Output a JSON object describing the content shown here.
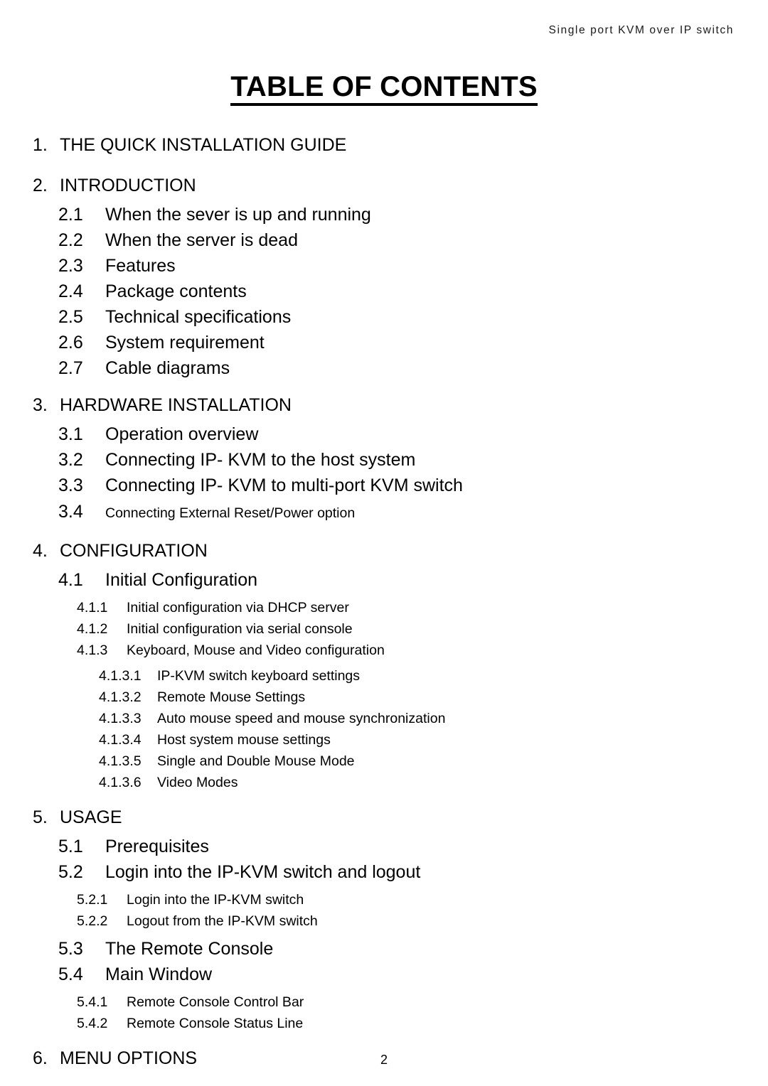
{
  "header": {
    "running_head": "Single port KVM over IP switch"
  },
  "title": "TABLE OF CONTENTS",
  "footer": {
    "page_number": "2"
  },
  "toc": {
    "entries": [
      {
        "level": 1,
        "number": "1.",
        "label": "THE QUICK INSTALLATION GUIDE"
      },
      {
        "level": 1,
        "number": "2.",
        "label": "INTRODUCTION"
      },
      {
        "level": 2,
        "number": "2.1",
        "label": "When the sever is up and running"
      },
      {
        "level": 2,
        "number": "2.2",
        "label": "When the server is dead"
      },
      {
        "level": 2,
        "number": "2.3",
        "label": "Features"
      },
      {
        "level": 2,
        "number": "2.4",
        "label": "Package contents"
      },
      {
        "level": 2,
        "number": "2.5",
        "label": "Technical specifications"
      },
      {
        "level": 2,
        "number": "2.6",
        "label": "System requirement"
      },
      {
        "level": 2,
        "number": "2.7",
        "label": "Cable diagrams"
      },
      {
        "level": 1,
        "number": "3.",
        "label": "HARDWARE INSTALLATION"
      },
      {
        "level": 2,
        "number": "3.1",
        "label": "Operation overview"
      },
      {
        "level": 2,
        "number": "3.2",
        "label": "Connecting IP- KVM to the host system"
      },
      {
        "level": 2,
        "number": "3.3",
        "label": "Connecting IP- KVM to multi-port KVM switch"
      },
      {
        "level": 2,
        "number": "3.4",
        "label": "Connecting External Reset/Power option",
        "small_label": true
      },
      {
        "level": 1,
        "number": "4.",
        "label": "CONFIGURATION"
      },
      {
        "level": 2,
        "number": "4.1",
        "label": "Initial Configuration"
      },
      {
        "level": 3,
        "number": "4.1.1",
        "label": "Initial configuration via DHCP server"
      },
      {
        "level": 3,
        "number": "4.1.2",
        "label": "Initial configuration via serial console"
      },
      {
        "level": 3,
        "number": "4.1.3",
        "label": "Keyboard, Mouse and Video configuration"
      },
      {
        "level": 4,
        "number": "4.1.3.1",
        "label": "IP-KVM switch keyboard settings"
      },
      {
        "level": 4,
        "number": "4.1.3.2",
        "label": "Remote Mouse Settings"
      },
      {
        "level": 4,
        "number": "4.1.3.3",
        "label": "Auto mouse speed and mouse synchronization"
      },
      {
        "level": 4,
        "number": "4.1.3.4",
        "label": "Host system mouse settings"
      },
      {
        "level": 4,
        "number": "4.1.3.5",
        "label": "Single and Double Mouse Mode"
      },
      {
        "level": 4,
        "number": "4.1.3.6",
        "label": "Video Modes"
      },
      {
        "level": 1,
        "number": "5.",
        "label": "USAGE"
      },
      {
        "level": 2,
        "number": "5.1",
        "label": "Prerequisites"
      },
      {
        "level": 2,
        "number": "5.2",
        "label": "Login into the IP-KVM switch and logout"
      },
      {
        "level": 3,
        "number": "5.2.1",
        "label": "Login into the IP-KVM switch"
      },
      {
        "level": 3,
        "number": "5.2.2",
        "label": "Logout from the IP-KVM switch"
      },
      {
        "level": 2,
        "number": "5.3",
        "label": "The Remote Console"
      },
      {
        "level": 2,
        "number": "5.4",
        "label": "Main Window"
      },
      {
        "level": 3,
        "number": "5.4.1",
        "label": "Remote Console Control Bar"
      },
      {
        "level": 3,
        "number": "5.4.2",
        "label": "Remote Console Status Line"
      },
      {
        "level": 1,
        "number": "6.",
        "label": "MENU OPTIONS"
      }
    ]
  }
}
